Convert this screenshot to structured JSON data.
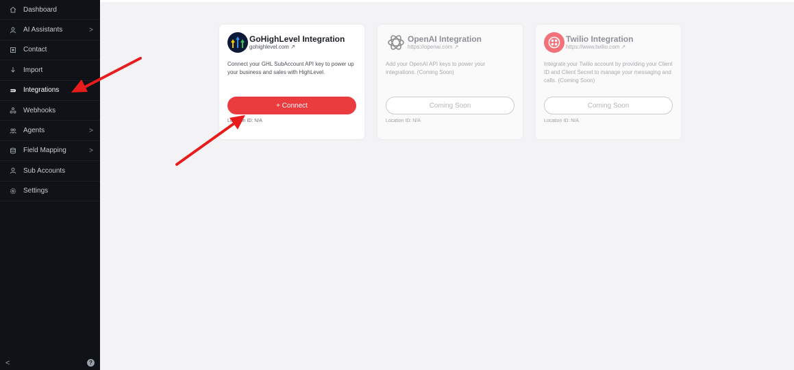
{
  "sidebar": {
    "items": [
      {
        "label": "Dashboard",
        "icon": "home-icon",
        "chevron": ""
      },
      {
        "label": "AI Assistants",
        "icon": "user-icon",
        "chevron": ">"
      },
      {
        "label": "Contact",
        "icon": "contact-icon",
        "chevron": ""
      },
      {
        "label": "Import",
        "icon": "import-icon",
        "chevron": ""
      },
      {
        "label": "Integrations",
        "icon": "plug-icon",
        "chevron": ""
      },
      {
        "label": "Webhooks",
        "icon": "webhook-icon",
        "chevron": ""
      },
      {
        "label": "Agents",
        "icon": "agents-icon",
        "chevron": ">"
      },
      {
        "label": "Field Mapping",
        "icon": "database-icon",
        "chevron": ">"
      },
      {
        "label": "Sub Accounts",
        "icon": "user-icon",
        "chevron": ""
      },
      {
        "label": "Settings",
        "icon": "gear-icon",
        "chevron": ""
      }
    ],
    "active": "Integrations",
    "collapse_label": "<",
    "help_label": "?"
  },
  "cards": [
    {
      "title": "GoHighLevel Integration",
      "link": "gohighlevel.com",
      "link_arrow": "↗",
      "description": "Connect your GHL SubAccount API key to power up your business and sales with HighLevel.",
      "button": "+ Connect",
      "location": "Location ID: N/A"
    },
    {
      "title": "OpenAI Integration",
      "link": "https://openai.com",
      "link_arrow": "↗",
      "description": "Add your OpenAI API keys to power your integrations. (Coming Soon)",
      "button": "Coming Soon",
      "location": "Location ID: N/A"
    },
    {
      "title": "Twilio Integration",
      "link": "https://www.twilio.com",
      "link_arrow": "↗",
      "description": "Integrate your Twilio account by providing your Client ID and Client Secret to manage your messaging and calls. (Coming Soon)",
      "button": "Coming Soon",
      "location": "Location ID: N/A"
    }
  ],
  "colors": {
    "sidebar_bg": "#0f1216",
    "accent": "#ea3b3f",
    "annotation_arrow": "#e81c1c"
  }
}
